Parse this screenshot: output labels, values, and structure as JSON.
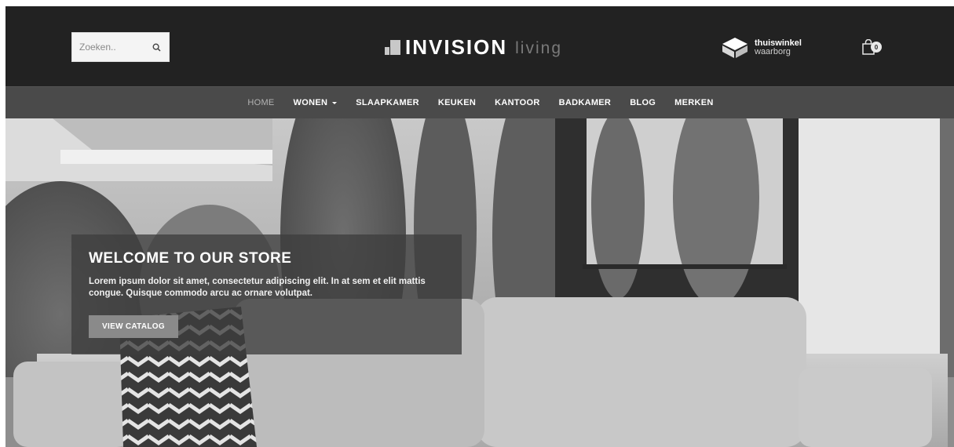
{
  "header": {
    "search": {
      "placeholder": "Zoeken.."
    },
    "logo": {
      "main": "INVISION",
      "sub": "living"
    },
    "badge": {
      "line1": "thuiswinkel",
      "line2": "waarborg"
    },
    "cart": {
      "count": "0"
    }
  },
  "nav": {
    "items": [
      "HOME",
      "WONEN",
      "SLAAPKAMER",
      "KEUKEN",
      "KANTOOR",
      "BADKAMER",
      "BLOG",
      "MERKEN"
    ]
  },
  "hero": {
    "title": "WELCOME TO OUR STORE",
    "text": "Lorem ipsum dolor sit amet, consectetur adipiscing elit. In at sem et elit mattis congue. Quisque commodo arcu ac ornare volutpat.",
    "cta": "VIEW CATALOG"
  },
  "icons": [
    "search-icon",
    "logo-mark-icon",
    "thuiswinkel-icon",
    "cart-icon"
  ],
  "colors": {
    "header_bg": "#222222",
    "nav_bg": "#4a4a4a",
    "nav_active": "#b4b4b4",
    "banner_bg": "#3e3e3e",
    "cta_bg": "#8a8a8a"
  }
}
